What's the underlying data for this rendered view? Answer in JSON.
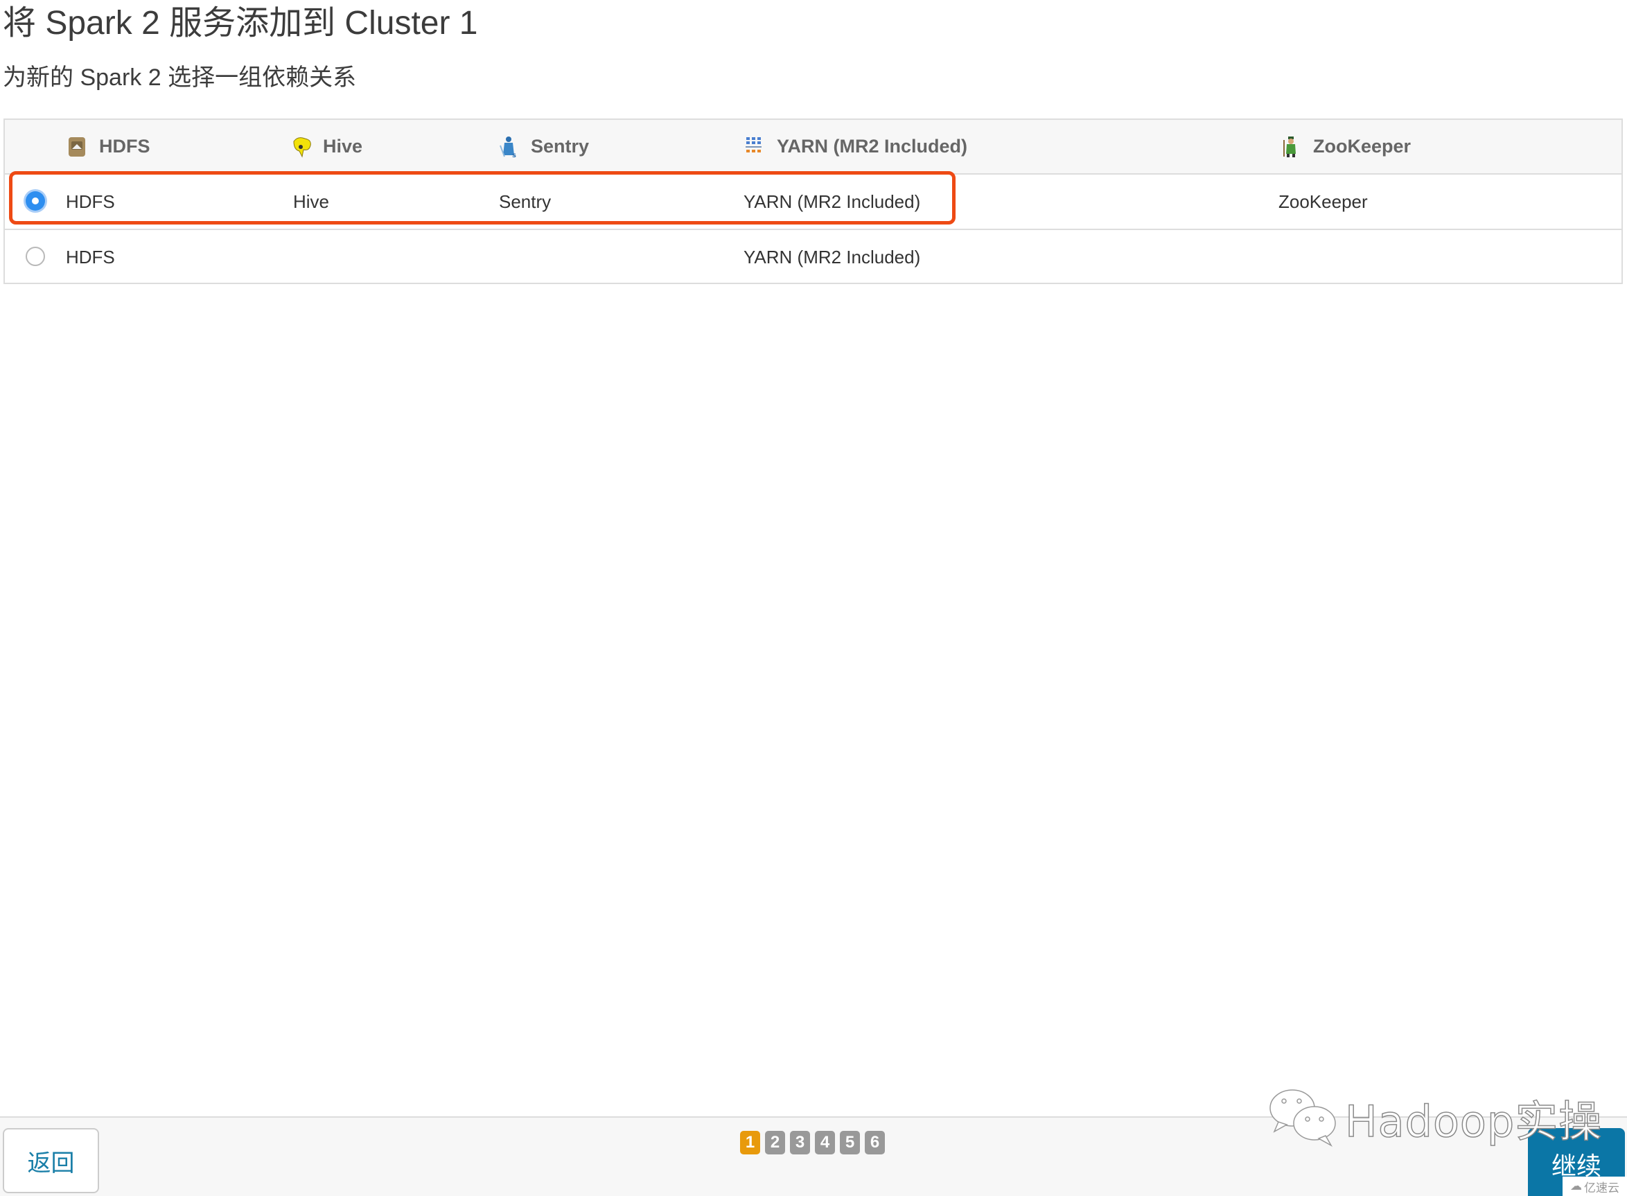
{
  "header": {
    "title": "将 Spark 2 服务添加到 Cluster 1",
    "subtitle": "为新的 Spark 2 选择一组依赖关系"
  },
  "table": {
    "columns": [
      {
        "label": "HDFS",
        "icon": "hdfs-icon"
      },
      {
        "label": "Hive",
        "icon": "hive-icon"
      },
      {
        "label": "Sentry",
        "icon": "sentry-icon"
      },
      {
        "label": "YARN (MR2 Included)",
        "icon": "yarn-icon"
      },
      {
        "label": "ZooKeeper",
        "icon": "zookeeper-icon"
      }
    ],
    "rows": [
      {
        "selected": true,
        "cells": [
          "HDFS",
          "Hive",
          "Sentry",
          "YARN (MR2 Included)",
          "ZooKeeper"
        ]
      },
      {
        "selected": false,
        "cells": [
          "HDFS",
          "",
          "",
          "YARN (MR2 Included)",
          ""
        ]
      }
    ]
  },
  "annotation": {
    "highlight_color": "#ee4a14"
  },
  "footer": {
    "back_label": "返回",
    "continue_label": "继续",
    "pages": [
      "1",
      "2",
      "3",
      "4",
      "5",
      "6"
    ],
    "current_page": "1",
    "accent_color": "#0b76a6",
    "page_active_color": "#e89a0c"
  },
  "watermark": {
    "text": "Hadoop实操",
    "logo": "wechat-icon",
    "corner_text": "亿速云"
  }
}
